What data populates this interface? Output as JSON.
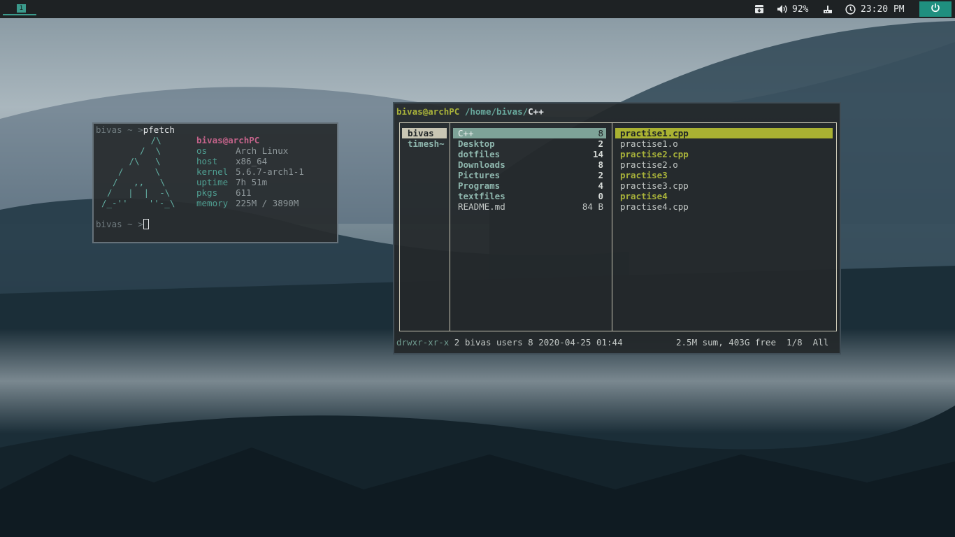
{
  "topbar": {
    "workspace": "1",
    "volume": "92%",
    "clock": "23:20 PM",
    "icons": [
      "archive-icon",
      "volume-icon",
      "network-icon",
      "clock-icon",
      "power-icon"
    ]
  },
  "pfetch": {
    "prompt_user": "bivas",
    "prompt_rest": " ~ >",
    "command": "pfetch",
    "logo": [
      "   /\\",
      "  /  \\",
      " /\\   \\",
      "/      \\",
      "/   ,,   \\",
      "/   |  |  -\\",
      "/_-''    ''-_\\"
    ],
    "user_host": "bivas@archPC",
    "info": [
      {
        "key": "os",
        "value": "Arch Linux"
      },
      {
        "key": "host",
        "value": "x86_64"
      },
      {
        "key": "kernel",
        "value": "5.6.7-arch1-1"
      },
      {
        "key": "uptime",
        "value": "7h 51m"
      },
      {
        "key": "pkgs",
        "value": "611"
      },
      {
        "key": "memory",
        "value": "225M / 3890M"
      }
    ]
  },
  "ranger": {
    "header_user": "bivas@archPC",
    "header_path": "/home/bivas/",
    "header_dir": "C++",
    "parent": [
      "bivas",
      "timesh~"
    ],
    "current": [
      {
        "name": "C++",
        "size": "8"
      },
      {
        "name": "Desktop",
        "size": "2"
      },
      {
        "name": "dotfiles",
        "size": "14"
      },
      {
        "name": "Downloads",
        "size": "8"
      },
      {
        "name": "Pictures",
        "size": "2"
      },
      {
        "name": "Programs",
        "size": "4"
      },
      {
        "name": "textfiles",
        "size": "0"
      },
      {
        "name": "README.md",
        "size": "84 B"
      }
    ],
    "preview": [
      {
        "name": "practise1.cpp",
        "style": "selected"
      },
      {
        "name": "practise1.o",
        "style": "plain"
      },
      {
        "name": "practise2.cpp",
        "style": "exec"
      },
      {
        "name": "practise2.o",
        "style": "plain"
      },
      {
        "name": "practise3",
        "style": "exec"
      },
      {
        "name": "practise3.cpp",
        "style": "plain"
      },
      {
        "name": "practise4",
        "style": "exec"
      },
      {
        "name": "practise4.cpp",
        "style": "plain"
      }
    ],
    "status_perms": "drwxr-xr-x",
    "status_info": " 2 bivas users 8 2020-04-25 01:44",
    "status_right": "2.5M sum, 403G free  1/8  All"
  },
  "colors": {
    "accent": "#3b9a8c",
    "selected_bg": "#aab232",
    "parent_sel_bg": "#c9c6b4",
    "current_sel_bg": "#7ea398"
  }
}
